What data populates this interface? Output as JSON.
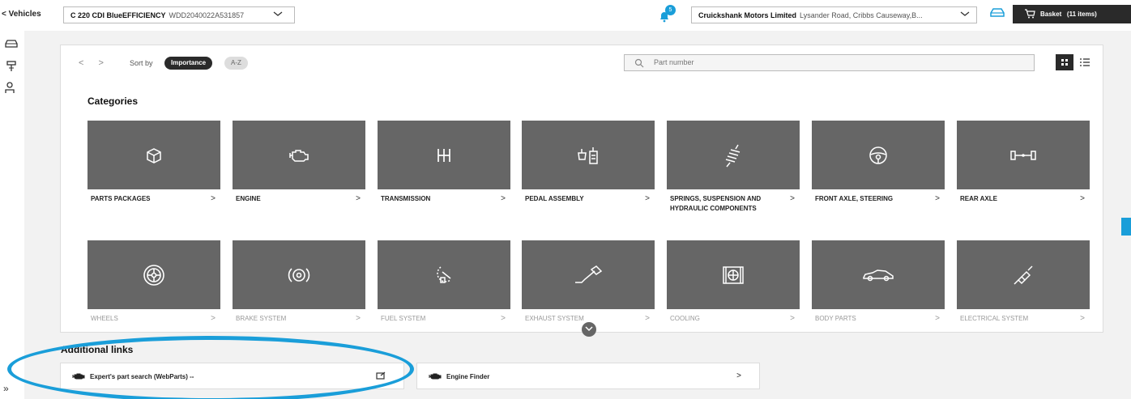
{
  "topbar": {
    "back_label": "< Vehicles",
    "vehicle_model": "C 220 CDI BlueEFFICIENCY",
    "vehicle_vin": "WDD2040022A531857",
    "notification_count": "5",
    "dealer_name": "Cruickshank Motors Limited",
    "dealer_address": "Lysander Road, Cribbs Causeway,B...",
    "basket_label": "Basket",
    "basket_count": "(11 items)"
  },
  "toolbar": {
    "prev": "<",
    "next": ">",
    "sort_by_label": "Sort by",
    "sort_importance": "Importance",
    "sort_az": "A-Z",
    "search_placeholder": "Part number"
  },
  "categories": {
    "heading": "Categories",
    "items": [
      {
        "label": "PARTS PACKAGES",
        "icon": "box-icon"
      },
      {
        "label": "ENGINE",
        "icon": "engine-icon"
      },
      {
        "label": "TRANSMISSION",
        "icon": "gearshift-icon"
      },
      {
        "label": "PEDAL ASSEMBLY",
        "icon": "pedal-icon"
      },
      {
        "label": "SPRINGS, SUSPENSION AND HYDRAULIC COMPONENTS",
        "icon": "spring-icon"
      },
      {
        "label": "FRONT AXLE, STEERING",
        "icon": "steering-wheel-icon"
      },
      {
        "label": "REAR AXLE",
        "icon": "axle-icon"
      },
      {
        "label": "WHEELS",
        "icon": "wheel-icon"
      },
      {
        "label": "BRAKE SYSTEM",
        "icon": "brake-icon"
      },
      {
        "label": "FUEL SYSTEM",
        "icon": "fuel-icon"
      },
      {
        "label": "EXHAUST SYSTEM",
        "icon": "exhaust-icon"
      },
      {
        "label": "COOLING",
        "icon": "radiator-icon"
      },
      {
        "label": "BODY PARTS",
        "icon": "car-body-icon"
      },
      {
        "label": "ELECTRICAL SYSTEM",
        "icon": "spark-plug-icon"
      }
    ],
    "arrow": ">"
  },
  "additional_links": {
    "heading": "Additional links",
    "items": [
      {
        "label": "Expert's part search (WebParts) --",
        "end_icon": "external-link-icon"
      },
      {
        "label": "Engine Finder",
        "end_icon": "chevron-right-icon"
      }
    ]
  },
  "colors": {
    "accent": "#1a9ed9",
    "tile": "#666666",
    "dark": "#2a2a2a"
  }
}
